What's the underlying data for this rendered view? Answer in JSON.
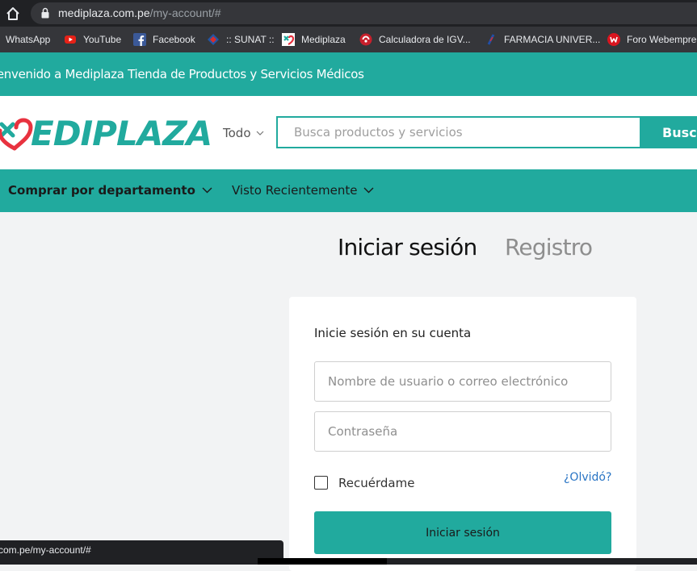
{
  "browser": {
    "url_domain": "mediplaza.com.pe",
    "url_path": "/my-account/#",
    "bookmarks": [
      {
        "label": "WhatsApp",
        "icon": "whatsapp-icon"
      },
      {
        "label": "YouTube",
        "icon": "youtube-icon"
      },
      {
        "label": "Facebook",
        "icon": "facebook-icon"
      },
      {
        "label": ":: SUNAT ::",
        "icon": "sunat-icon"
      },
      {
        "label": "Mediplaza",
        "icon": "mediplaza-icon"
      },
      {
        "label": "Calculadora de IGV...",
        "icon": "calculator-icon"
      },
      {
        "label": "FARMACIA UNIVER...",
        "icon": "pharmacy-icon"
      },
      {
        "label": "Foro Webempre",
        "icon": "forum-icon"
      }
    ],
    "status_text": "com.pe/my-account/#"
  },
  "site": {
    "announcement": "ienvenido a Mediplaza Tienda de Productos y Servicios Médicos",
    "logo_text": "EDIPLAZA",
    "category_select": "Todo",
    "search_placeholder": "Busca productos y servicios",
    "search_button": "Buscar",
    "nav": {
      "departments": "Comprar por departamento",
      "recent": "Visto Recientemente"
    }
  },
  "account": {
    "tab_login": "Iniciar sesión",
    "tab_register": "Registro",
    "card_title": "Inicie sesión en su cuenta",
    "username_placeholder": "Nombre de usuario o correo electrónico",
    "password_placeholder": "Contraseña",
    "remember_label": "Recuérdame",
    "forgot_link": "¿Olvidó?",
    "login_button": "Iniciar sesión"
  },
  "colors": {
    "brand": "#21aa9e",
    "logo_heart": "#e8323f",
    "link": "#2874c4"
  }
}
